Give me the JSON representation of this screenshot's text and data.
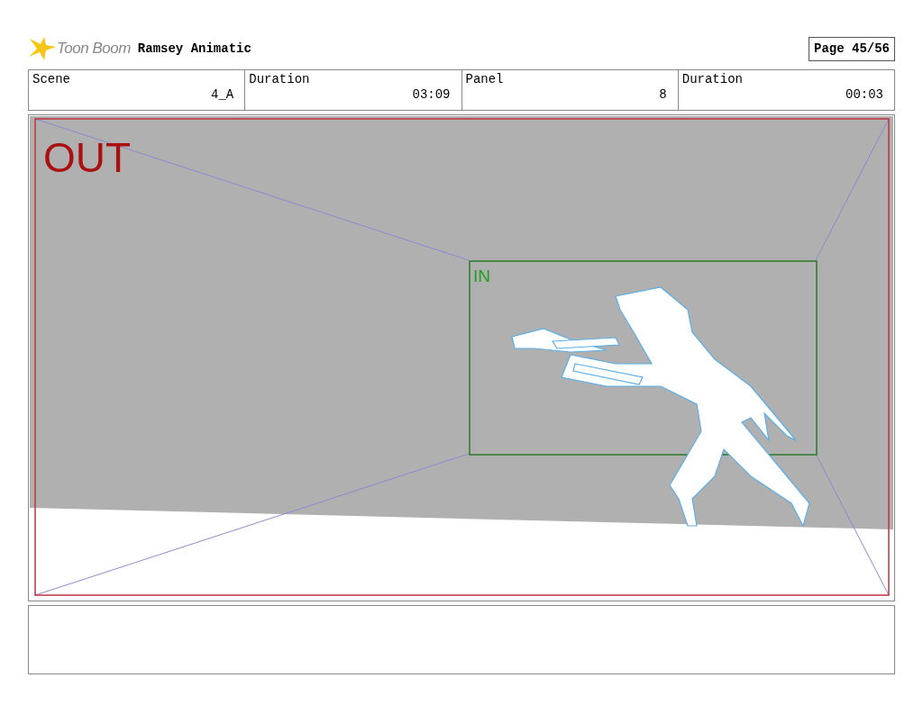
{
  "header": {
    "logo": "Toon Boom",
    "title": "Ramsey Animatic",
    "page": "Page 45/56"
  },
  "fields": [
    {
      "label": "Scene",
      "value": "4_A"
    },
    {
      "label": "Duration",
      "value": "03:09"
    },
    {
      "label": "Panel",
      "value": "8"
    },
    {
      "label": "Duration",
      "value": "00:03"
    }
  ],
  "panel": {
    "out_label": "OUT",
    "in_label": "IN"
  }
}
